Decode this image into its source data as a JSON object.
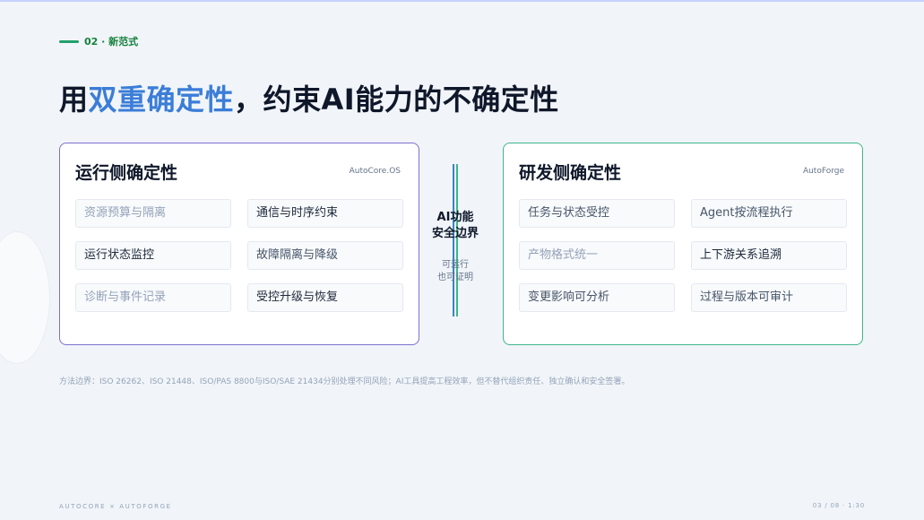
{
  "section": {
    "label": "02 · 新范式"
  },
  "title": {
    "prefix": "用",
    "highlight": "双重确定性",
    "suffix": "，约束AI能力的不确定性"
  },
  "runtime_panel": {
    "title": "运行侧确定性",
    "brand": "AutoCore.OS",
    "items": [
      {
        "label": "资源预算与隔离"
      },
      {
        "label": "通信与时序约束"
      },
      {
        "label": "运行状态监控"
      },
      {
        "label": "故障隔离与降级"
      },
      {
        "label": "诊断与事件记录"
      },
      {
        "label": "受控升级与恢复"
      }
    ]
  },
  "boundary": {
    "line1": "AI功能",
    "line2": "安全边界",
    "sub1": "可运行",
    "sub2": "也可证明"
  },
  "dev_panel": {
    "title": "研发侧确定性",
    "brand": "AutoForge",
    "items": [
      {
        "label": "任务与状态受控"
      },
      {
        "label": "Agent按流程执行"
      },
      {
        "label": "产物格式统一"
      },
      {
        "label": "上下游关系追溯"
      },
      {
        "label": "变更影响可分析"
      },
      {
        "label": "过程与版本可审计"
      }
    ]
  },
  "note": "方法边界：ISO 26262、ISO 21448、ISO/PAS 8800与ISO/SAE 21434分别处理不同风险；AI工具提高工程效率，但不替代组织责任、独立确认和安全签署。",
  "footer": {
    "left": "AUTOCORE × AUTOFORGE",
    "right": "03 / 08 · 1:30"
  },
  "colors": {
    "accent_blue": "#3b7dd8",
    "runtime_border": "#7c6fd0",
    "dev_border": "#3fb58a",
    "tag_green": "#22a06b"
  }
}
